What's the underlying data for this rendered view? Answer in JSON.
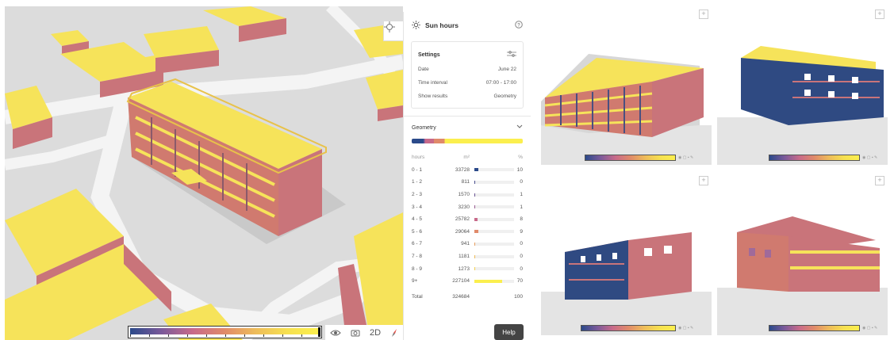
{
  "panel": {
    "title": "Sun hours",
    "settings": {
      "heading": "Settings",
      "rows": [
        {
          "label": "Date",
          "value": "June 22"
        },
        {
          "label": "Time interval",
          "value": "07:00 - 17:00"
        },
        {
          "label": "Show results",
          "value": "Geometry"
        }
      ]
    },
    "geometry_label": "Geometry",
    "table": {
      "headers": {
        "hours": "hours",
        "area": "m²",
        "pct": "%"
      },
      "rows": [
        {
          "hours": "0 - 1",
          "area": "33728",
          "pct": "10",
          "color": "#2b4a8a"
        },
        {
          "hours": "1 - 2",
          "area": "811",
          "pct": "0",
          "color": "#4a4f8e"
        },
        {
          "hours": "2 - 3",
          "area": "1570",
          "pct": "1",
          "color": "#6a5592"
        },
        {
          "hours": "3 - 4",
          "area": "3230",
          "pct": "1",
          "color": "#9a5e93"
        },
        {
          "hours": "4 - 5",
          "area": "25782",
          "pct": "8",
          "color": "#c86a8a"
        },
        {
          "hours": "5 - 6",
          "area": "29064",
          "pct": "9",
          "color": "#e08a6a"
        },
        {
          "hours": "6 - 7",
          "area": "941",
          "pct": "0",
          "color": "#e8a060"
        },
        {
          "hours": "7 - 8",
          "area": "1181",
          "pct": "0",
          "color": "#eebc5a"
        },
        {
          "hours": "8 - 9",
          "area": "1273",
          "pct": "0",
          "color": "#f3d254"
        },
        {
          "hours": "9+",
          "area": "227104",
          "pct": "70",
          "color": "#fbef4e"
        }
      ],
      "total": {
        "label": "Total",
        "area": "324684",
        "pct": "100"
      }
    }
  },
  "help_label": "Help",
  "view_toggle_label": "2D",
  "colors": {
    "sunny": "#f6e35a",
    "shade_dark": "#2f4a82",
    "mid": "#c9747a",
    "ground": "#dcdcdc",
    "road": "#f3f3f3"
  }
}
